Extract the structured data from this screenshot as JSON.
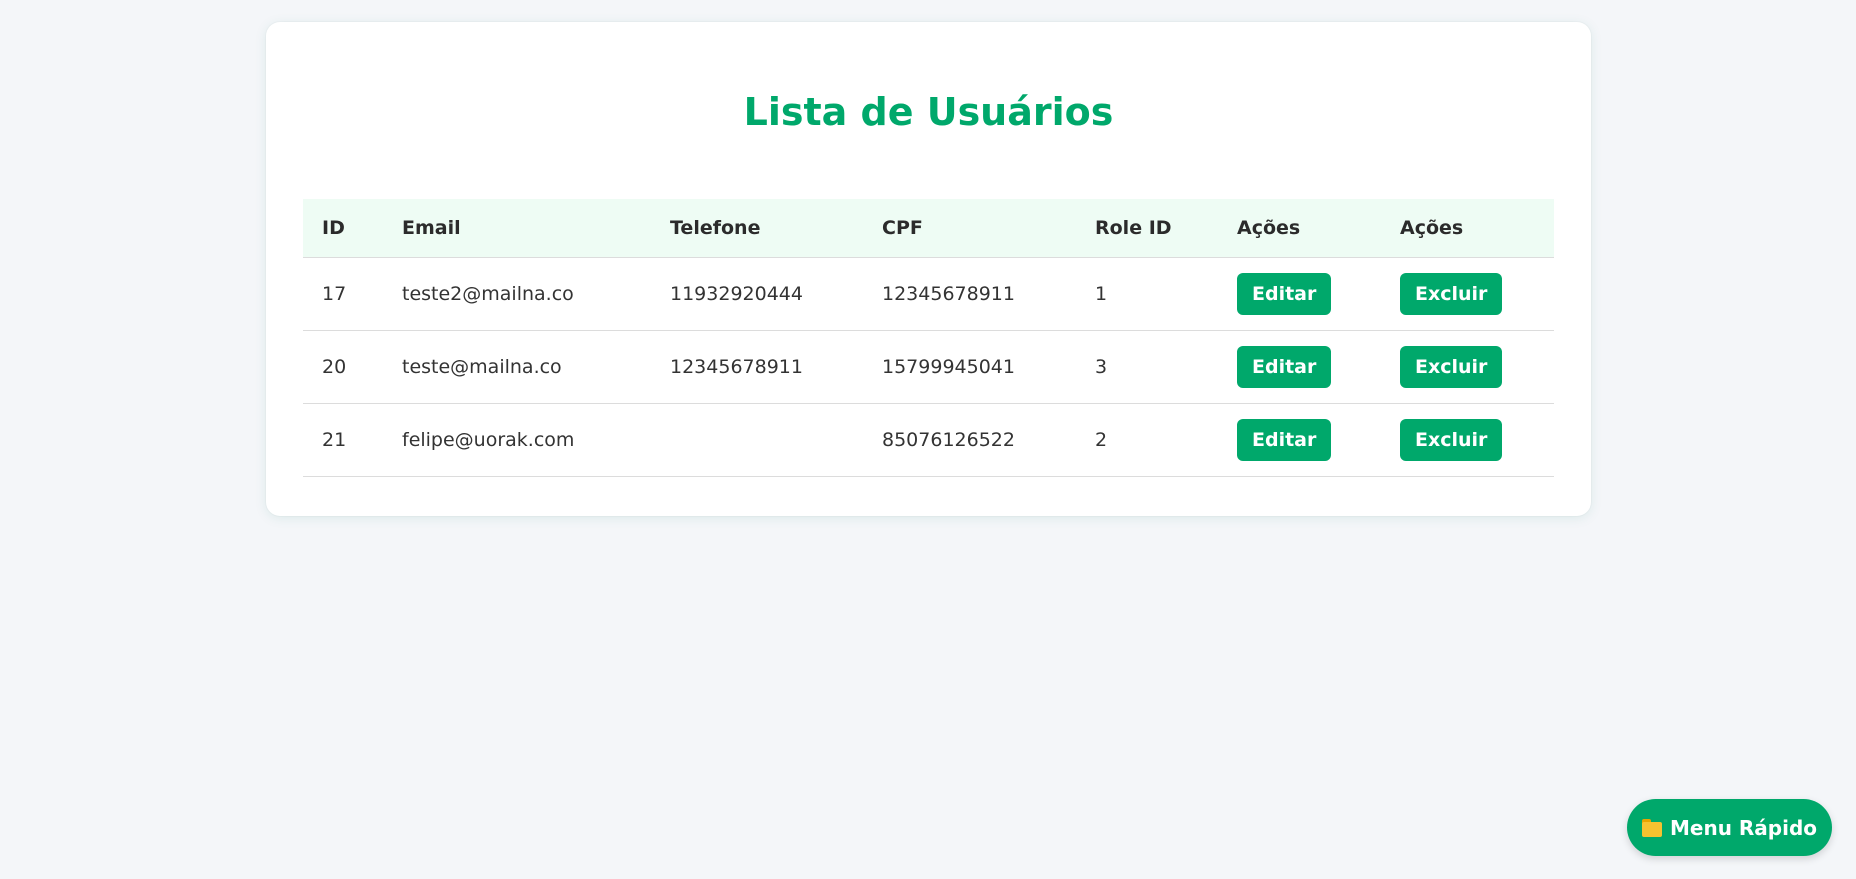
{
  "page": {
    "title": "Lista de Usuários"
  },
  "table": {
    "headers": [
      "ID",
      "Email",
      "Telefone",
      "CPF",
      "Role ID",
      "Ações",
      "Ações"
    ],
    "rows": [
      {
        "id": "17",
        "email": "teste2@mailna.co",
        "telefone": "11932920444",
        "cpf": "12345678911",
        "role_id": "1"
      },
      {
        "id": "20",
        "email": "teste@mailna.co",
        "telefone": "12345678911",
        "cpf": "15799945041",
        "role_id": "3"
      },
      {
        "id": "21",
        "email": "felipe@uorak.com",
        "telefone": "",
        "cpf": "85076126522",
        "role_id": "2"
      }
    ],
    "edit_label": "Editar",
    "delete_label": "Excluir"
  },
  "quick_menu": {
    "label": "Menu Rápido",
    "icon": "folder-icon"
  },
  "colors": {
    "accent": "#00a86b",
    "header_bg": "#eefcf4",
    "page_bg": "#f4f6f9"
  }
}
